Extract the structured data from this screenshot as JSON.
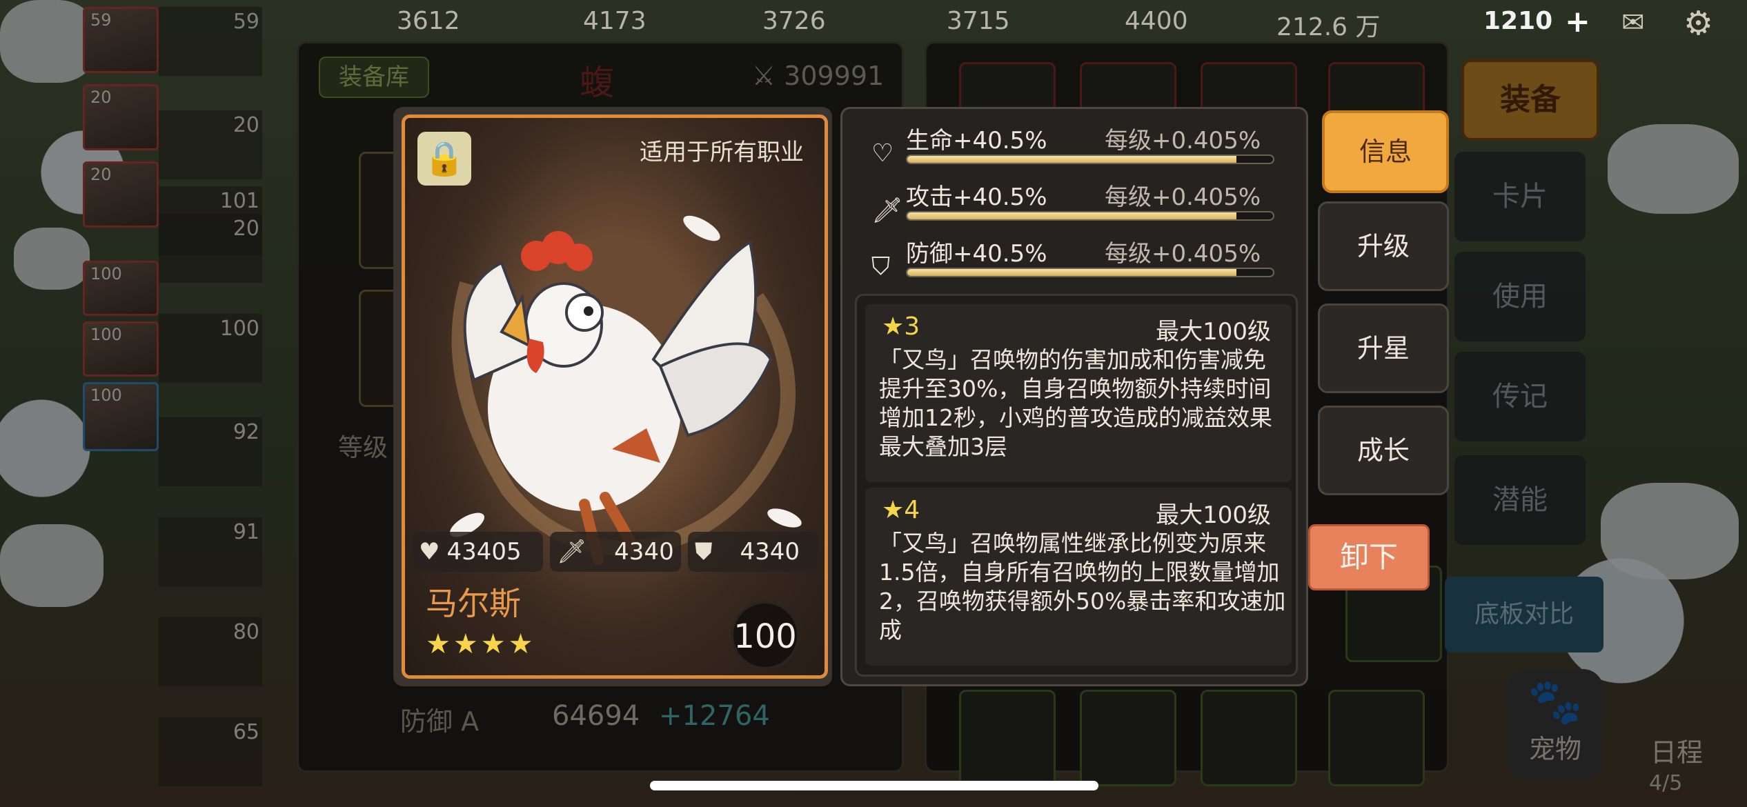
{
  "topbar": {
    "resources": [
      "3612",
      "4173",
      "3726",
      "3715",
      "4400",
      "212.6 万",
      "1210"
    ],
    "plus": "+",
    "gear": "⚙",
    "mail": "✉"
  },
  "roster": {
    "tiles": [
      "59",
      "20",
      "20",
      "100",
      "100",
      "100"
    ],
    "levels": [
      "59",
      "20",
      "101",
      "20",
      "100",
      "92",
      "91",
      "80",
      "65"
    ]
  },
  "library": {
    "tab": "装备库",
    "red_char": "蝮",
    "power": "309991",
    "level_label": "等级",
    "defense_label": "防御 A",
    "defense_value": "64694",
    "defense_bonus": "+12764"
  },
  "side_menu": {
    "equip": "装备",
    "card": "卡片",
    "use": "使用",
    "biography": "传记",
    "potential": "潜能",
    "compare": "底板对比"
  },
  "bottom_nav": {
    "pet": "宠物",
    "schedule": "日程",
    "schedule_count": "4/5"
  },
  "pet_card": {
    "class_restriction": "适用于所有职业",
    "hp": "43405",
    "attack": "4340",
    "defense": "4340",
    "name": "马尔斯",
    "stars": "★★★★",
    "star_count": 4,
    "level": "100"
  },
  "info": {
    "stats": [
      {
        "icon": "heart-icon",
        "name": "生命+40.5%",
        "per_level": "每级+0.405%",
        "fill": 0.9
      },
      {
        "icon": "sword-icon",
        "name": "攻击+40.5%",
        "per_level": "每级+0.405%",
        "fill": 0.9
      },
      {
        "icon": "shield-icon",
        "name": "防御+40.5%",
        "per_level": "每级+0.405%",
        "fill": 0.9
      }
    ],
    "skills": [
      {
        "star": "★3",
        "max_level": "最大100级",
        "desc": "「又鸟」召唤物的伤害加成和伤害减免提升至30%，自身召唤物额外持续时间增加12秒，小鸡的普攻造成的减益效果最大叠加3层"
      },
      {
        "star": "★4",
        "max_level": "最大100级",
        "desc": "「又鸟」召唤物属性继承比例变为原来1.5倍，自身所有召唤物的上限数量增加2，召唤物获得额外50%暴击率和攻速加成"
      }
    ]
  },
  "tabs": {
    "info": "信息",
    "upgrade": "升级",
    "star_up": "升星",
    "growth": "成长",
    "unequip": "卸下"
  },
  "colors": {
    "card_border": "#e08a3a",
    "active_tab": "#f1a83e",
    "unequip": "#e7825c",
    "star": "#f6d54a",
    "name": "#e89a4a"
  }
}
